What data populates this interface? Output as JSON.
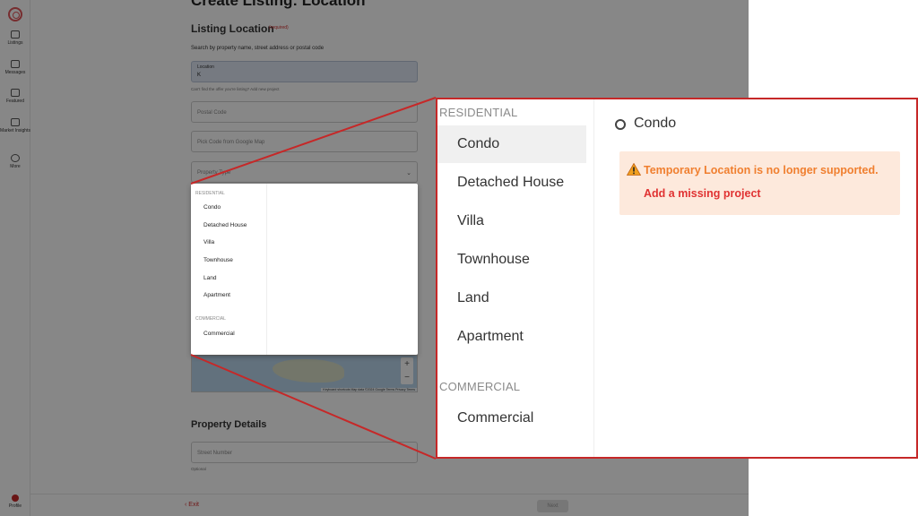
{
  "header": {
    "title": "Create Listing: Location"
  },
  "sidebar": {
    "items": [
      {
        "label": "Listings",
        "icon": "list-icon"
      },
      {
        "label": "Messages",
        "icon": "message-icon"
      },
      {
        "label": "Featured",
        "icon": "featured-icon"
      },
      {
        "label": "Market Insights",
        "icon": "insights-icon"
      },
      {
        "label": "More",
        "icon": "more-icon"
      }
    ],
    "profile_label": "Profile"
  },
  "listing_location": {
    "title": "Listing Location",
    "required_tag": "(required)",
    "search_help": "Search by property name, street address or postal code",
    "location_field": {
      "label": "Location",
      "value": "K"
    },
    "location_hint": "Can't find the offer you're listing? Add new project",
    "postal_code_placeholder": "Postal Code",
    "pin_code_placeholder": "Pick Code from Google Map",
    "property_type_placeholder": "Property Type"
  },
  "map": {
    "attribution": "Keyboard shortcuts   Map data ©2024 Google   Terms   Privacy   Terms"
  },
  "property_details": {
    "title": "Property Details",
    "street_number_placeholder": "Street Number",
    "street_number_hint": "Optional"
  },
  "footer": {
    "exit_label": "‹ Exit",
    "next_label": "Next"
  },
  "property_type_dropdown": {
    "groups": [
      {
        "name": "RESIDENTIAL",
        "options": [
          "Condo",
          "Detached House",
          "Villa",
          "Townhouse",
          "Land",
          "Apartment"
        ]
      },
      {
        "name": "COMMERCIAL",
        "options": [
          "Commercial"
        ]
      }
    ],
    "selected": "Condo"
  },
  "zoom_panel": {
    "radio_option": "Condo",
    "warning_text": "Temporary Location is no longer supported.",
    "warning_link": "Add a missing project"
  },
  "colors": {
    "accent_red": "#c62828",
    "warning_orange": "#f07f2f",
    "warning_bg": "#fde9dc",
    "link_red": "#e03232"
  }
}
